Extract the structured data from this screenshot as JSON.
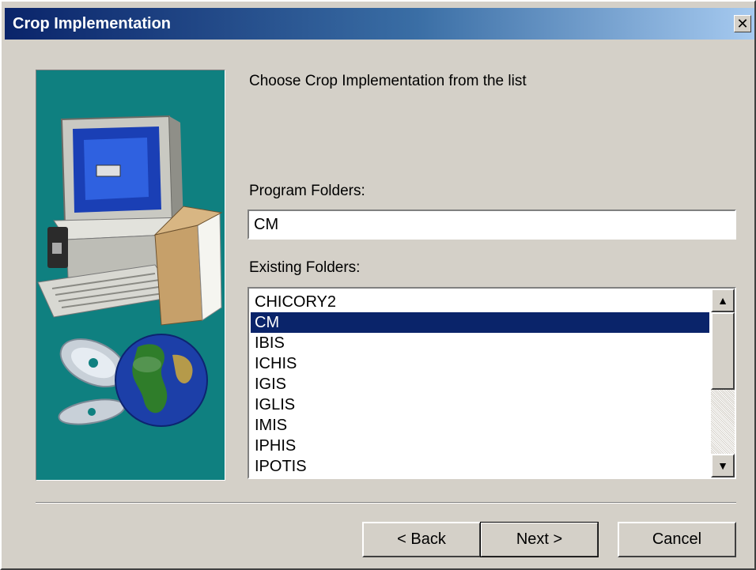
{
  "window": {
    "title": "Crop Implementation",
    "close_icon": "close-icon",
    "close_glyph": "✕"
  },
  "illustration": {
    "icon": "computer-globe-illustration",
    "background_color": "#0f8080"
  },
  "instructions": "Choose Crop Implementation from the list",
  "program_folders": {
    "label": "Program Folders:",
    "value": "CM"
  },
  "existing_folders": {
    "label": "Existing Folders:",
    "items": [
      {
        "label": "CHICORY2"
      },
      {
        "label": "CM",
        "selected": true
      },
      {
        "label": "IBIS"
      },
      {
        "label": "ICHIS"
      },
      {
        "label": "IGIS"
      },
      {
        "label": "IGLIS"
      },
      {
        "label": "IMIS"
      },
      {
        "label": "IPHIS"
      },
      {
        "label": "IPOTIS"
      }
    ],
    "selected_color": "#0a246a"
  },
  "buttons": {
    "back": "< Back",
    "next": "Next >",
    "cancel": "Cancel"
  },
  "scrollbar": {
    "up_icon": "scroll-up-arrow-icon",
    "down_icon": "scroll-down-arrow-icon",
    "up_glyph": "▲",
    "down_glyph": "▼"
  }
}
